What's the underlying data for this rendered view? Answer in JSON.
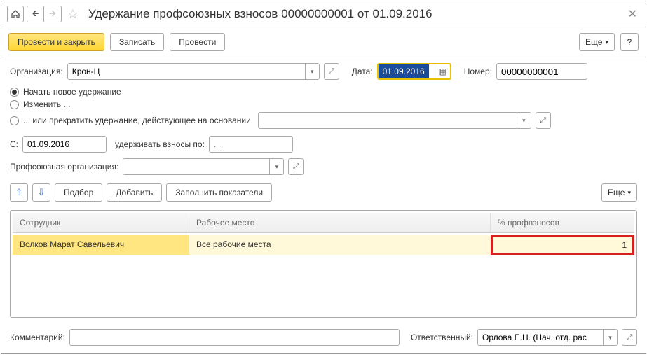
{
  "title": "Удержание профсоюзных взносов 00000000001 от 01.09.2016",
  "actions": {
    "post_close": "Провести и закрыть",
    "save": "Записать",
    "post": "Провести",
    "more": "Еще",
    "help": "?"
  },
  "header": {
    "org_label": "Организация:",
    "org_value": "Крон-Ц",
    "date_label": "Дата:",
    "date_value": "01.09.2016",
    "number_label": "Номер:",
    "number_value": "00000000001"
  },
  "radios": {
    "start": "Начать новое удержание",
    "change": "Изменить ...",
    "stop": "... или прекратить удержание, действующее на основании"
  },
  "period": {
    "from_label": "С:",
    "from_value": "01.09.2016",
    "to_label": "удерживать взносы по:",
    "to_placeholder": ".  ."
  },
  "union": {
    "label": "Профсоюзная организация:"
  },
  "table_actions": {
    "pick": "Подбор",
    "add": "Добавить",
    "fill": "Заполнить показатели",
    "more": "Еще"
  },
  "columns": {
    "employee": "Сотрудник",
    "workplace": "Рабочее место",
    "percent": "% профвзносов"
  },
  "rows": [
    {
      "employee": "Волков Марат Савельевич",
      "workplace": "Все рабочие места",
      "percent": "1"
    }
  ],
  "footer": {
    "comment_label": "Комментарий:",
    "responsible_label": "Ответственный:",
    "responsible_value": "Орлова Е.Н. (Нач. отд. рас"
  }
}
